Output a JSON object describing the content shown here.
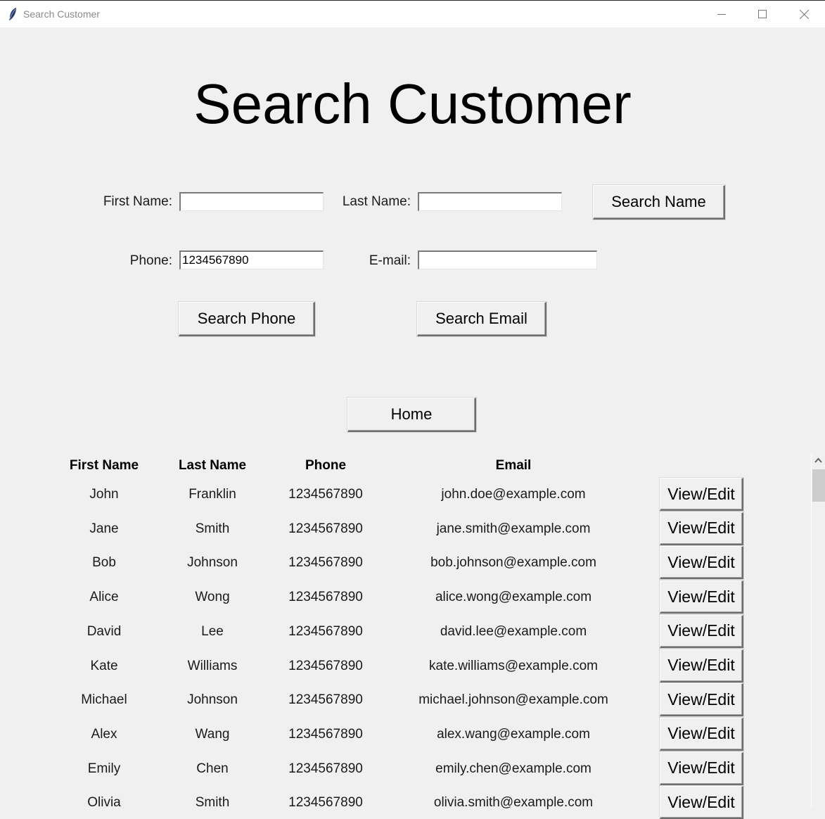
{
  "window": {
    "title": "Search Customer",
    "icon": "feather-icon",
    "controls": [
      "minimize-icon",
      "maximize-icon",
      "close-icon"
    ]
  },
  "heading": "Search Customer",
  "form": {
    "first_name_label": "First Name:",
    "first_name_value": "",
    "last_name_label": "Last Name:",
    "last_name_value": "",
    "phone_label": "Phone:",
    "phone_value": "1234567890",
    "email_label": "E-mail:",
    "email_value": "",
    "search_name_button": "Search Name",
    "search_phone_button": "Search Phone",
    "search_email_button": "Search Email",
    "home_button": "Home"
  },
  "table": {
    "columns": [
      "First Name",
      "Last Name",
      "Phone",
      "Email"
    ],
    "action_label": "View/Edit",
    "rows": [
      {
        "first": "John",
        "last": "Franklin",
        "phone": "1234567890",
        "email": "john.doe@example.com"
      },
      {
        "first": "Jane",
        "last": "Smith",
        "phone": "1234567890",
        "email": "jane.smith@example.com"
      },
      {
        "first": "Bob",
        "last": "Johnson",
        "phone": "1234567890",
        "email": "bob.johnson@example.com"
      },
      {
        "first": "Alice",
        "last": "Wong",
        "phone": "1234567890",
        "email": "alice.wong@example.com"
      },
      {
        "first": "David",
        "last": "Lee",
        "phone": "1234567890",
        "email": "david.lee@example.com"
      },
      {
        "first": "Kate",
        "last": "Williams",
        "phone": "1234567890",
        "email": "kate.williams@example.com"
      },
      {
        "first": "Michael",
        "last": "Johnson",
        "phone": "1234567890",
        "email": "michael.johnson@example.com"
      },
      {
        "first": "Alex",
        "last": "Wang",
        "phone": "1234567890",
        "email": "alex.wang@example.com"
      },
      {
        "first": "Emily",
        "last": "Chen",
        "phone": "1234567890",
        "email": "emily.chen@example.com"
      },
      {
        "first": "Olivia",
        "last": "Smith",
        "phone": "1234567890",
        "email": "olivia.smith@example.com"
      }
    ]
  }
}
